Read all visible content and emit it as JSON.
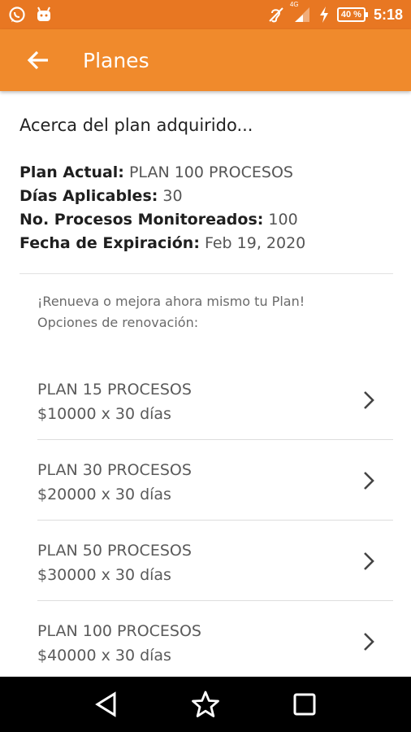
{
  "status_bar": {
    "network_label": "4G",
    "battery_label": "40 %",
    "time": "5:18"
  },
  "app_bar": {
    "title": "Planes"
  },
  "plan": {
    "section_title": "Acerca del plan adquirido...",
    "current_label": "Plan Actual:",
    "current_value": "PLAN 100 PROCESOS",
    "days_label": "Días Aplicables:",
    "days_value": "30",
    "processes_label": "No. Procesos Monitoreados:",
    "processes_value": "100",
    "expiration_label": "Fecha de Expiración:",
    "expiration_value": "Feb 19, 2020"
  },
  "renewal": {
    "line1": "¡Renueva o mejora ahora mismo tu Plan!",
    "line2": "Opciones de renovación:",
    "options": [
      {
        "name": "PLAN 15 PROCESOS",
        "price": "$10000 x 30 días"
      },
      {
        "name": "PLAN 30 PROCESOS",
        "price": "$20000 x 30 días"
      },
      {
        "name": "PLAN 50 PROCESOS",
        "price": "$30000 x 30 días"
      },
      {
        "name": "PLAN 100 PROCESOS",
        "price": "$40000 x 30 días"
      }
    ]
  },
  "colors": {
    "status_bar": "#e87722",
    "app_bar": "#f08a2c"
  }
}
